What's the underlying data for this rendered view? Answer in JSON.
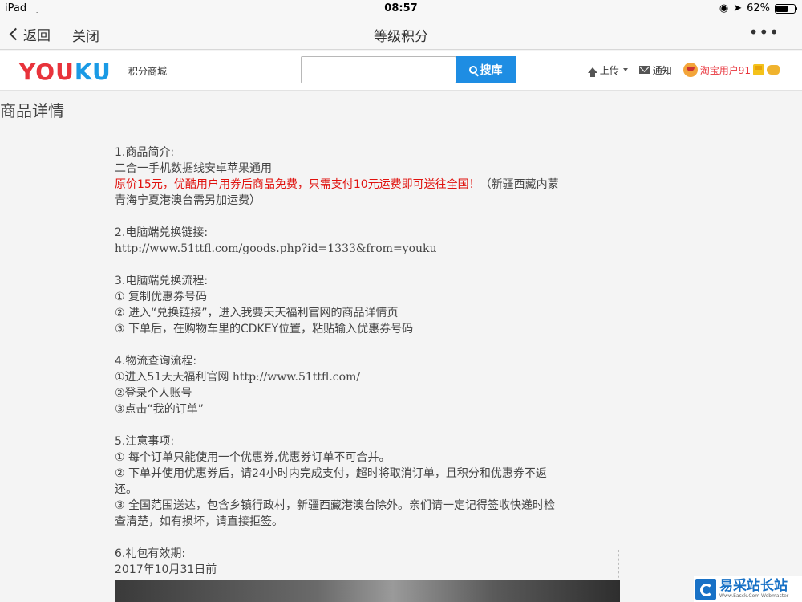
{
  "status_bar": {
    "device": "iPad",
    "time": "08:57",
    "battery_text": "62%",
    "battery_level": 0.62
  },
  "nav": {
    "back_label": "返回",
    "close_label": "关闭",
    "title": "等级积分",
    "more_label": "•••"
  },
  "header": {
    "logo_part1": "YOU",
    "logo_part2": "KU",
    "subtitle": "积分商城",
    "search_value": "",
    "search_button": "搜库",
    "upload_label": "上传",
    "notify_label": "通知",
    "user_name": "淘宝用户91"
  },
  "page_title": "商品详情",
  "article": {
    "s1_title": "1.商品简介:",
    "s1_line1": "二合一手机数据线安卓苹果通用",
    "s1_highlight": "原价15元，优酷用户用券后商品免费，只需支付10元运费即可送往全国！",
    "s1_note": "（新疆西藏内蒙青海宁夏港澳台需另加运费）",
    "s2_title": "2.电脑端兑换链接:",
    "s2_url": "http://www.51ttfl.com/goods.php?id=1333&from=youku",
    "s3_title": "3.电脑端兑换流程:",
    "s3_step1": "① 复制优惠券号码",
    "s3_step2": "② 进入“兑换链接”，进入我要天天福利官网的商品详情页",
    "s3_step3": "③ 下单后，在购物车里的CDKEY位置，粘贴输入优惠券号码",
    "s4_title": "4.物流查询流程:",
    "s4_step1_text": "①进入51天天福利官网 ",
    "s4_step1_url": "http://www.51ttfl.com/",
    "s4_step2": "②登录个人账号",
    "s4_step3": "③点击“我的订单”",
    "s5_title": "5.注意事项:",
    "s5_item1": "① 每个订单只能使用一个优惠券,优惠券订单不可合并。",
    "s5_item2": "② 下单并使用优惠券后，请24小时内完成支付，超时将取消订单，且积分和优惠券不返还。",
    "s5_item3": "③ 全国范围送达，包含乡镇行政村，新疆西藏港澳台除外。亲们请一定记得签收快递时检查清楚，如有损坏，请直接拒签。",
    "s6_title": "6.礼包有效期:",
    "s6_date": "2017年10月31日前"
  },
  "watermark": {
    "main": "易采站长站",
    "sub": "Www.Easck.Com Webmaster"
  }
}
